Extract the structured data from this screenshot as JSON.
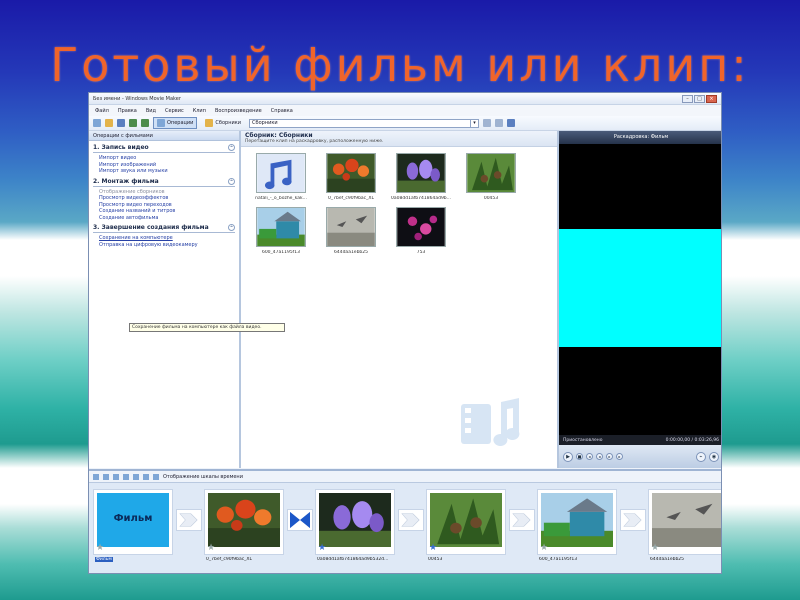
{
  "slide": {
    "title": "Готовый фильм или клип:"
  },
  "window": {
    "title": "Без имени - Windows Movie Maker",
    "menu": [
      "Файл",
      "Правка",
      "Вид",
      "Сервис",
      "Клип",
      "Воспроизведение",
      "Справка"
    ],
    "toolbar": {
      "tasks_label": "Операции",
      "collections_label": "Сборники",
      "collection_select": "Сборники"
    }
  },
  "tasks_pane": {
    "header": "Операции с фильмами",
    "sections": [
      {
        "title": "1. Запись видео",
        "links": [
          {
            "label": "Импорт видео",
            "dim": false
          },
          {
            "label": "Импорт изображений",
            "dim": false
          },
          {
            "label": "Импорт звука или музыки",
            "dim": false
          }
        ]
      },
      {
        "title": "2. Монтаж фильма",
        "links": [
          {
            "label": "Отображение сборников",
            "dim": true
          },
          {
            "label": "Просмотр видеоэффектов",
            "dim": false
          },
          {
            "label": "Просмотр видео переходов",
            "dim": false
          },
          {
            "label": "Создание названий и титров",
            "dim": false
          },
          {
            "label": "Создание автофильма",
            "dim": false
          }
        ]
      },
      {
        "title": "3. Завершение создания фильма",
        "links": [
          {
            "label": "Сохранение на компьютере",
            "dim": false
          },
          {
            "label": "Отправка на цифровую видеокамеру",
            "dim": false
          }
        ]
      }
    ],
    "tooltip": "Сохранение фильма на компьютере как файла видео."
  },
  "collection_pane": {
    "title": "Сборник: Сборники",
    "subtitle": "Перетащите клип на раскадровку, расположенную ниже.",
    "clips": [
      {
        "caption": "natali_-_o_bozhe_kak...",
        "kind": "music"
      },
      {
        "caption": "0_7bef_c90f9bac_XL",
        "kind": "red-flowers"
      },
      {
        "caption": "0a08dd1afb741864ad9b...",
        "kind": "purple-flowers"
      },
      {
        "caption": "00453",
        "kind": "green"
      },
      {
        "caption": "600_47a1195f13",
        "kind": "house"
      },
      {
        "caption": "644daa1ebb25",
        "kind": "birds"
      },
      {
        "caption": "753",
        "kind": "dark-flowers"
      }
    ]
  },
  "preview_pane": {
    "title": "Раскадровка: Фильм",
    "status": "Приостановлено",
    "time": "0:00:00,00 / 0:03:26,96"
  },
  "storyboard": {
    "toolbar_label": "Отображение шкалы времени",
    "items": [
      {
        "caption": "Фильм",
        "tile_text": "Фильм",
        "kind": "title",
        "star": "grey",
        "selected": true
      },
      {
        "caption": "0_7bef_c90f9bac_XL",
        "kind": "red-flowers",
        "star": "grey"
      },
      {
        "caption": "0a08dd1afb741864ad9b532d...",
        "kind": "purple-flowers",
        "star": "blue"
      },
      {
        "caption": "00453",
        "kind": "green",
        "star": "blue"
      },
      {
        "caption": "600_47a1195f13",
        "kind": "house",
        "star": "grey"
      },
      {
        "caption": "644daa1ebb25",
        "kind": "birds",
        "star": "grey"
      }
    ],
    "transitions": [
      "arrow",
      "bowtie",
      "arrow",
      "arrow",
      "arrow",
      "arrow"
    ]
  },
  "colors": {
    "title": "#f0642a",
    "preview_cyan": "#00ffff",
    "film_tile": "#1fa8e8",
    "link": "#2741a6"
  }
}
